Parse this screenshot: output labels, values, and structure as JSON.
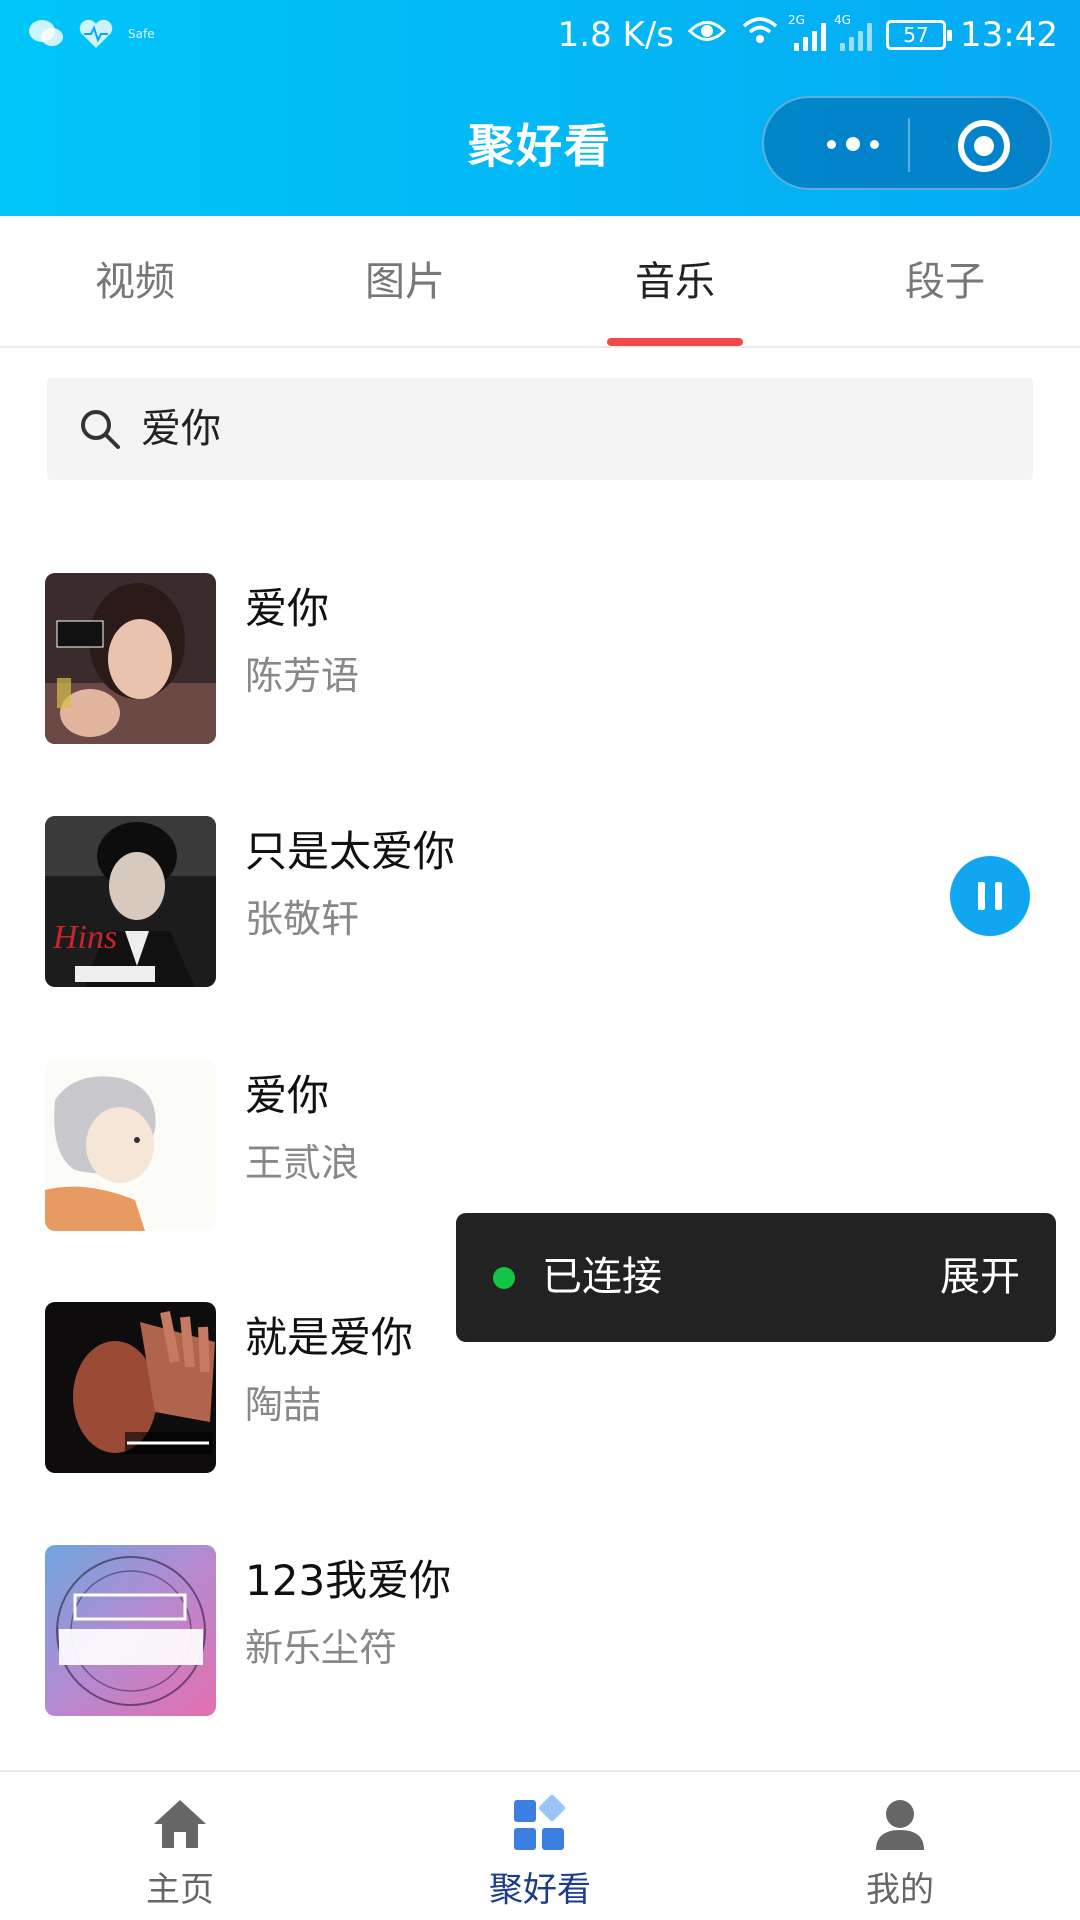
{
  "status_bar": {
    "safe_label": "Safe",
    "network_speed": "1.8 K/s",
    "signal_2g": "2G",
    "signal_4g": "4G",
    "battery": "57",
    "time": "13:42"
  },
  "header": {
    "title": "聚好看"
  },
  "tabs": [
    {
      "label": "视频"
    },
    {
      "label": "图片"
    },
    {
      "label": "音乐"
    },
    {
      "label": "段子"
    }
  ],
  "active_tab": "音乐",
  "search": {
    "value": "爱你"
  },
  "songs": [
    {
      "title": "爱你",
      "artist": "陈芳语"
    },
    {
      "title": "只是太爱你",
      "artist": "张敬轩",
      "playing": true
    },
    {
      "title": "爱你",
      "artist": "王贰浪"
    },
    {
      "title": "就是爱你",
      "artist": "陶喆"
    },
    {
      "title": "123我爱你",
      "artist": "新乐尘符"
    }
  ],
  "toast": {
    "status": "已连接",
    "action": "展开"
  },
  "bottom_nav": [
    {
      "label": "主页",
      "icon": "home-icon"
    },
    {
      "label": "聚好看",
      "icon": "grid-icon",
      "active": true
    },
    {
      "label": "我的",
      "icon": "user-icon"
    }
  ],
  "colors": {
    "header_gradient_start": "#00c6f8",
    "header_gradient_end": "#06aaf3",
    "tab_indicator": "#f04a4a",
    "play_button": "#11a7f0",
    "toast_background": "#222222",
    "connected_dot": "#14c445",
    "active_nav_label": "#1a3c8c"
  }
}
